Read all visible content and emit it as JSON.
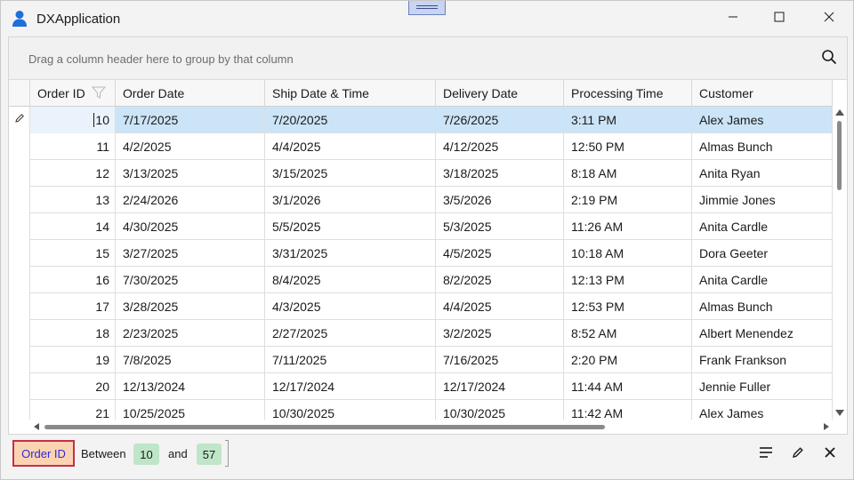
{
  "window": {
    "title": "DXApplication",
    "icons": {
      "app": "user-icon",
      "minimize": "minimize-icon",
      "maximize": "maximize-icon",
      "close": "close-icon"
    }
  },
  "group_panel": {
    "text": "Drag a column header here to group by that column",
    "search_icon": "search-icon"
  },
  "columns": [
    {
      "key": "order_id",
      "label": "Order ID"
    },
    {
      "key": "order_date",
      "label": "Order Date"
    },
    {
      "key": "ship_date",
      "label": "Ship Date & Time"
    },
    {
      "key": "delivery_date",
      "label": "Delivery Date"
    },
    {
      "key": "processing_time",
      "label": "Processing Time"
    },
    {
      "key": "customer",
      "label": "Customer"
    }
  ],
  "rows": [
    {
      "id": "10",
      "order_date": "7/17/2025",
      "ship_date": "7/20/2025",
      "delivery_date": "7/26/2025",
      "processing_time": "3:11 PM",
      "customer": "Alex James"
    },
    {
      "id": "11",
      "order_date": "4/2/2025",
      "ship_date": "4/4/2025",
      "delivery_date": "4/12/2025",
      "processing_time": "12:50 PM",
      "customer": "Almas Bunch"
    },
    {
      "id": "12",
      "order_date": "3/13/2025",
      "ship_date": "3/15/2025",
      "delivery_date": "3/18/2025",
      "processing_time": "8:18 AM",
      "customer": "Anita Ryan"
    },
    {
      "id": "13",
      "order_date": "2/24/2026",
      "ship_date": "3/1/2026",
      "delivery_date": "3/5/2026",
      "processing_time": "2:19 PM",
      "customer": "Jimmie Jones"
    },
    {
      "id": "14",
      "order_date": "4/30/2025",
      "ship_date": "5/5/2025",
      "delivery_date": "5/3/2025",
      "processing_time": "11:26 AM",
      "customer": "Anita Cardle"
    },
    {
      "id": "15",
      "order_date": "3/27/2025",
      "ship_date": "3/31/2025",
      "delivery_date": "4/5/2025",
      "processing_time": "10:18 AM",
      "customer": "Dora Geeter"
    },
    {
      "id": "16",
      "order_date": "7/30/2025",
      "ship_date": "8/4/2025",
      "delivery_date": "8/2/2025",
      "processing_time": "12:13 PM",
      "customer": "Anita Cardle"
    },
    {
      "id": "17",
      "order_date": "3/28/2025",
      "ship_date": "4/3/2025",
      "delivery_date": "4/4/2025",
      "processing_time": "12:53 PM",
      "customer": "Almas Bunch"
    },
    {
      "id": "18",
      "order_date": "2/23/2025",
      "ship_date": "2/27/2025",
      "delivery_date": "3/2/2025",
      "processing_time": "8:52 AM",
      "customer": "Albert Menendez"
    },
    {
      "id": "19",
      "order_date": "7/8/2025",
      "ship_date": "7/11/2025",
      "delivery_date": "7/16/2025",
      "processing_time": "2:20 PM",
      "customer": "Frank Frankson"
    },
    {
      "id": "20",
      "order_date": "12/13/2024",
      "ship_date": "12/17/2024",
      "delivery_date": "12/17/2024",
      "processing_time": "11:44 AM",
      "customer": "Jennie Fuller"
    },
    {
      "id": "21",
      "order_date": "10/25/2025",
      "ship_date": "10/30/2025",
      "delivery_date": "10/30/2025",
      "processing_time": "11:42 AM",
      "customer": "Alex James"
    }
  ],
  "focused_row_icon": "pencil-icon",
  "filter_panel": {
    "field": "Order ID",
    "operator": "Between",
    "value_from": "10",
    "conjunction": "and",
    "value_to": "57",
    "icons": {
      "customize": "filter-lines-icon",
      "edit": "pencil-icon",
      "clear": "close-icon"
    }
  },
  "colors": {
    "focused_row": "#cce4f7",
    "filter_field_bg": "#fbd3b3",
    "filter_field_border": "#c0304a",
    "filter_value_bg": "#bfe6c8",
    "app_icon": "#1e6fd9"
  }
}
